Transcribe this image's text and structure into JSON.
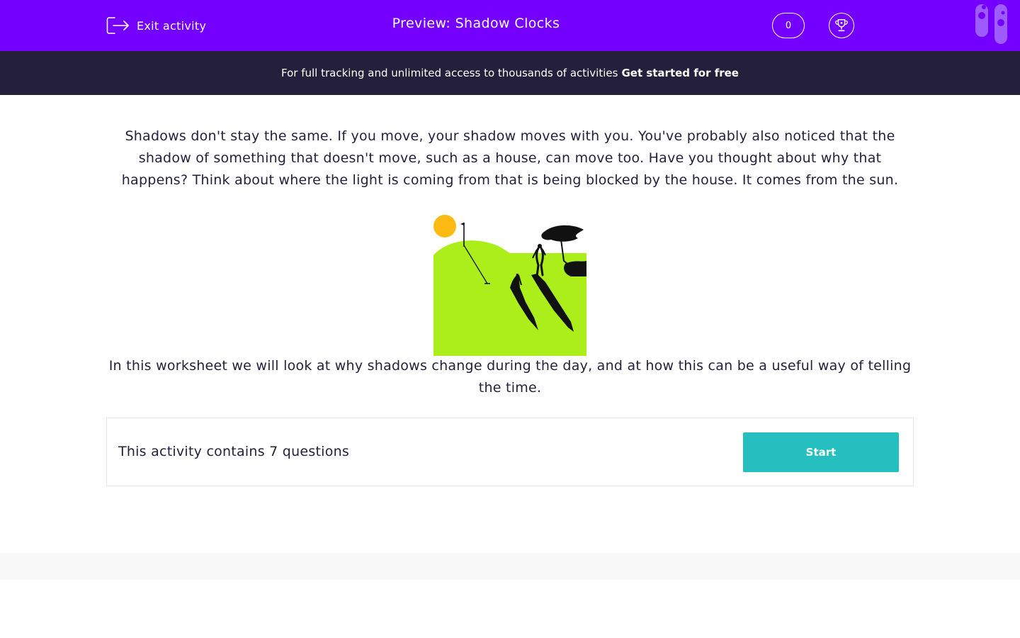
{
  "header": {
    "exit_label": "Exit activity",
    "title": "Preview: Shadow Clocks",
    "score": "0"
  },
  "banner": {
    "text": "For full tracking and unlimited access to thousands of activities",
    "link": "Get started for free"
  },
  "content": {
    "intro": "Shadows don't stay the same. If you move, your shadow moves with you. You've probably also noticed that the shadow of something that doesn't move, such as a house, can move too. Have you thought about why that happens? Think about where the light is coming from that is being blocked by the house. It comes from the sun.",
    "summary": "In this worksheet we will look at why shadows change during the day, and at how this can be a useful way of telling the time."
  },
  "card": {
    "text": "This activity contains 7 questions",
    "start_label": "Start"
  },
  "colors": {
    "header_bg": "#7400ff",
    "banner_bg": "#241f3b",
    "text": "#241f3b",
    "accent": "#25bfbf",
    "grass": "#acee1a",
    "sun": "#fcba12"
  },
  "icons": {
    "exit": "exit-icon",
    "trophy": "trophy-icon"
  }
}
